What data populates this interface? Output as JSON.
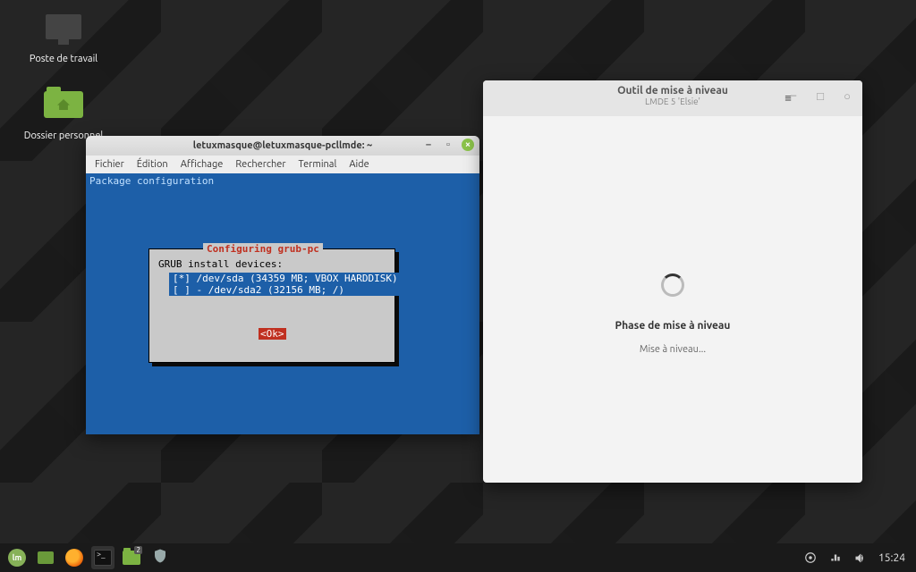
{
  "desktop": {
    "icon_computer_label": "Poste de travail",
    "icon_home_label": "Dossier personnel"
  },
  "terminal": {
    "title": "letuxmasque@letuxmasque-pcllmde: ~",
    "menu": [
      "Fichier",
      "Édition",
      "Affichage",
      "Rechercher",
      "Terminal",
      "Aide"
    ],
    "pkg_line": "Package configuration",
    "grub": {
      "box_title": "Configuring grub-pc",
      "prompt": "GRUB install devices:",
      "options": [
        "[*] /dev/sda (34359 MB; VBOX HARDDISK)",
        "[ ] - /dev/sda2 (32156 MB; /)"
      ],
      "ok_label": "<Ok>"
    }
  },
  "upgrade": {
    "title": "Outil de mise à niveau",
    "subtitle": "LMDE 5 'Elsie'",
    "phase_title": "Phase de mise à niveau",
    "phase_status": "Mise à niveau..."
  },
  "taskbar": {
    "workspace_badge": "2",
    "clock": "15:24"
  }
}
